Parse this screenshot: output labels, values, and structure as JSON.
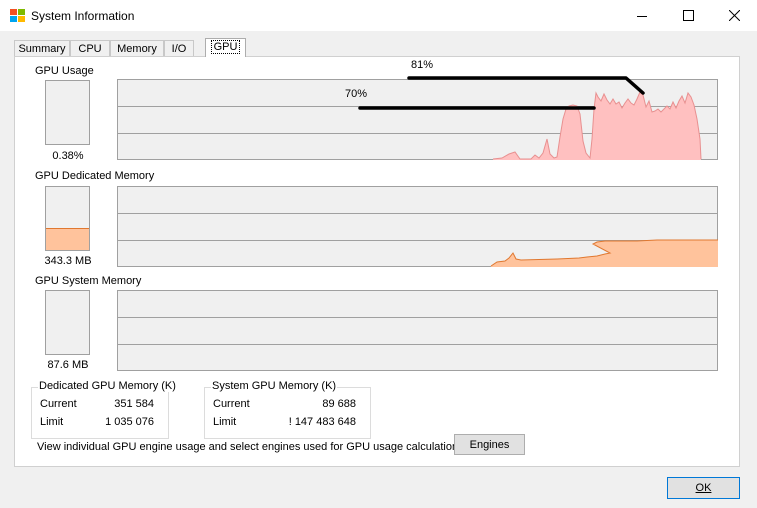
{
  "window": {
    "title": "System Information"
  },
  "tabs": [
    {
      "id": "summary",
      "label": "Summary"
    },
    {
      "id": "cpu",
      "label": "CPU"
    },
    {
      "id": "memory",
      "label": "Memory"
    },
    {
      "id": "io",
      "label": "I/O"
    },
    {
      "id": "gpu",
      "label": "GPU"
    }
  ],
  "active_tab": "gpu",
  "gpu_usage": {
    "label": "GPU Usage",
    "value": "0.38%",
    "level_fraction": 0.0038
  },
  "dedicated_memory": {
    "label": "GPU Dedicated Memory",
    "value": "343.3 MB",
    "level_fraction": 0.34
  },
  "system_memory": {
    "label": "GPU System Memory",
    "value": "87.6 MB",
    "level_fraction": 0.0
  },
  "annotations": {
    "peak_label": "81%",
    "secondary_label": "70%"
  },
  "dedicated_group": {
    "title": "Dedicated GPU Memory (K)",
    "current_label": "Current",
    "current_value": "351 584",
    "limit_label": "Limit",
    "limit_value": "1 035 076"
  },
  "system_group": {
    "title": "System GPU Memory (K)",
    "current_label": "Current",
    "current_value": "89 688",
    "limit_label": "Limit",
    "limit_value": "! 147 483 648"
  },
  "footer": {
    "description": "View individual GPU engine usage and select engines used for GPU usage calculations:",
    "engines_button": "Engines"
  },
  "ok_button": "OK",
  "colors": {
    "usage_fill": "#ffc0c0",
    "usage_line": "#e89090",
    "memory_fill": "#ffc39c",
    "memory_line": "#e07830",
    "graph_bg": "#f0f0f0",
    "grid": "#a0a0a0"
  }
}
